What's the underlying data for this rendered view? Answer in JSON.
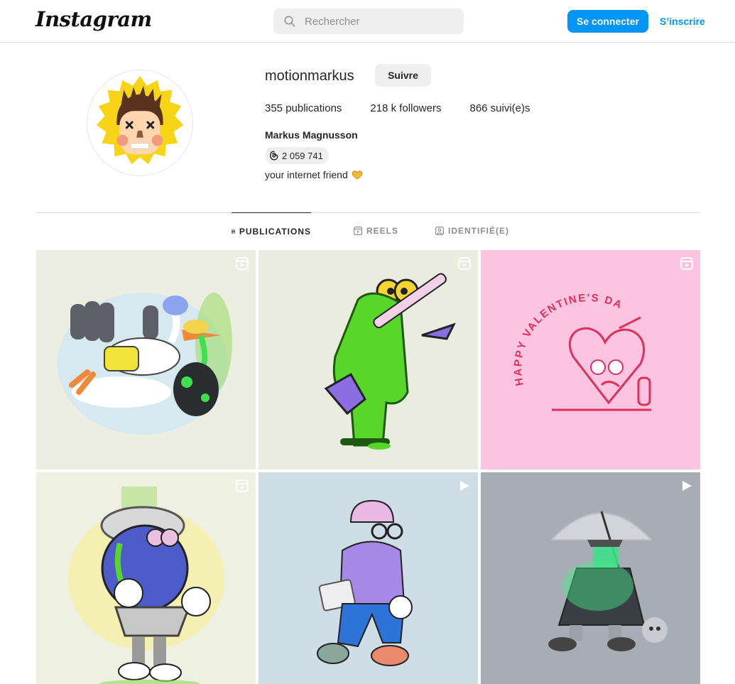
{
  "header": {
    "logo": "Instagram",
    "search_placeholder": "Rechercher",
    "login_label": "Se connecter",
    "signup_label": "S’inscrire",
    "accent_color": "#0095f6"
  },
  "profile": {
    "username": "motionmarkus",
    "follow_label": "Suivre",
    "stats": {
      "posts": "355 publications",
      "followers": "218 k followers",
      "following": "866 suivi(e)s"
    },
    "full_name": "Markus Magnusson",
    "threads_count": "2 059 741",
    "bio": "your internet friend"
  },
  "tabs": [
    {
      "label": "PUBLICATIONS",
      "icon": "grid-icon",
      "active": true
    },
    {
      "label": "REELS",
      "icon": "reels-icon",
      "active": false
    },
    {
      "label": "IDENTIFIÉ(E)",
      "icon": "tagged-icon",
      "active": false
    }
  ],
  "posts": [
    {
      "type": "reel",
      "background": "#edeee2",
      "subject": "stork carrying slime"
    },
    {
      "type": "reel",
      "background": "#e9ecdf",
      "subject": "green slime guitarist"
    },
    {
      "type": "reel",
      "background": "#fcc4e0",
      "subject": "valentine heart",
      "caption": "HAPPY VALENTINE'S DAY"
    },
    {
      "type": "reel",
      "background": "#eef0e2",
      "subject": "blueberry with bucket"
    },
    {
      "type": "video",
      "background": "#cfdde6",
      "subject": "purple hoodie walker"
    },
    {
      "type": "video",
      "background": "#a6adb4",
      "subject": "umbrella detective"
    }
  ]
}
